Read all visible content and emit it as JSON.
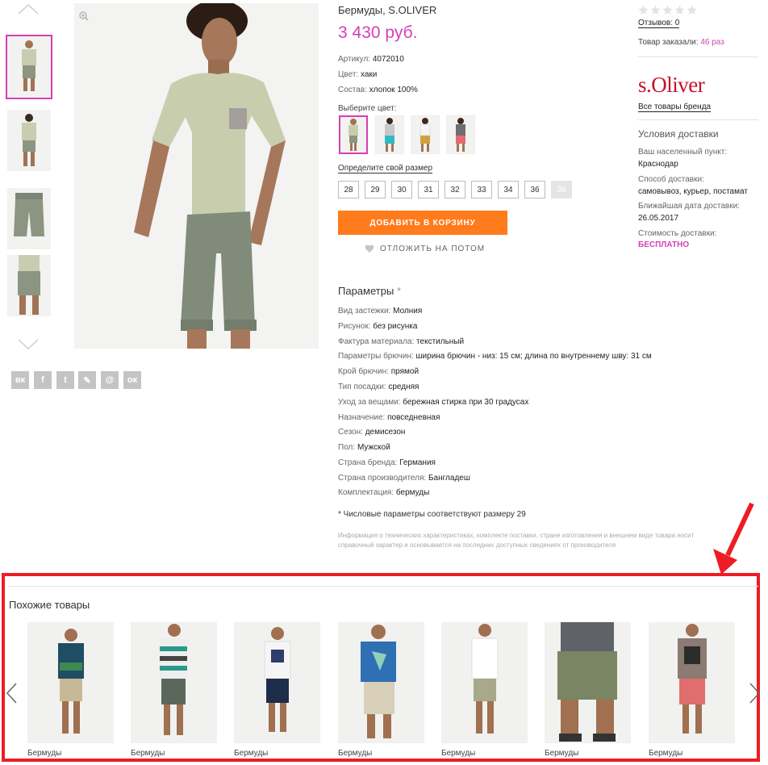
{
  "product": {
    "title": "Бермуды, S.OLIVER",
    "price": "3 430 руб.",
    "article_label": "Артикул:",
    "article_value": "4072010",
    "color_label": "Цвет:",
    "color_value": "хаки",
    "composition_label": "Состав:",
    "composition_value": "хлопок 100%",
    "choose_color_label": "Выберите цвет:",
    "size_link": "Определите свой размер",
    "sizes": [
      "28",
      "29",
      "30",
      "31",
      "32",
      "33",
      "34",
      "36",
      "38"
    ],
    "unavailable_size": "38",
    "add_to_cart": "ДОБАВИТЬ В КОРЗИНУ",
    "save_later": "ОТЛОЖИТЬ НА ПОТОМ"
  },
  "params": {
    "title": "Параметры",
    "asterisk": "*",
    "rows": [
      {
        "label": "Вид застежки:",
        "value": "Молния"
      },
      {
        "label": "Рисунок:",
        "value": "без рисунка"
      },
      {
        "label": "Фактура материала:",
        "value": "текстильный"
      },
      {
        "label": "Параметры брючин:",
        "value": "ширина брючин - низ: 15 см; длина по внутреннему шву: 31 см"
      },
      {
        "label": "Крой брючин:",
        "value": "прямой"
      },
      {
        "label": "Тип посадки:",
        "value": "средняя"
      },
      {
        "label": "Уход за вещами:",
        "value": "бережная стирка при 30 градусах"
      },
      {
        "label": "Назначение:",
        "value": "повседневная"
      },
      {
        "label": "Сезон:",
        "value": "демисезон"
      },
      {
        "label": "Пол:",
        "value": "Мужской"
      },
      {
        "label": "Страна бренда:",
        "value": "Германия"
      },
      {
        "label": "Страна производителя:",
        "value": "Бангладеш"
      },
      {
        "label": "Комплектация:",
        "value": "бермуды"
      }
    ],
    "footnote": "* Числовые параметры соответствуют размеру 29",
    "disclaimer_1": "Информация о технических характеристиках, комплекте поставки, стране изготовления и внешнем виде товара носит",
    "disclaimer_2": "справочный характер и основывается на последних доступных сведениях от производителя"
  },
  "sidebar": {
    "reviews": "Отзывов: 0",
    "ordered_prefix": "Товар заказали:",
    "ordered_value": "46 раз",
    "brand_logo": "s.Oliver",
    "brand_link": "Все товары бренда",
    "delivery_title": "Условия доставки",
    "locality_label": "Ваш населенный пункт:",
    "locality_value": "Краснодар",
    "method_label": "Способ доставки:",
    "method_value": "самовывоз, курьер, постамат",
    "date_label": "Ближайшая дата доставки:",
    "date_value": "26.05.2017",
    "cost_label": "Стоимость доставки:",
    "cost_value": "БЕСПЛАТНО"
  },
  "social": [
    "vk-icon",
    "facebook-icon",
    "twitter-icon",
    "livejournal-icon",
    "mail-icon",
    "odnoklassniki-icon"
  ],
  "social_glyphs": [
    "вк",
    "f",
    "t",
    "✎",
    "@",
    "ок"
  ],
  "similar": {
    "title": "Похожие товары",
    "items": [
      "Бермуды",
      "Бермуды",
      "Бермуды",
      "Бермуды",
      "Бермуды",
      "Бермуды",
      "Бермуды"
    ]
  },
  "colors": {
    "accent_pink": "#d63fb6",
    "cart_orange": "#ff7b1c",
    "annotation_red": "#ee1c24",
    "brand_red": "#c8102e"
  }
}
